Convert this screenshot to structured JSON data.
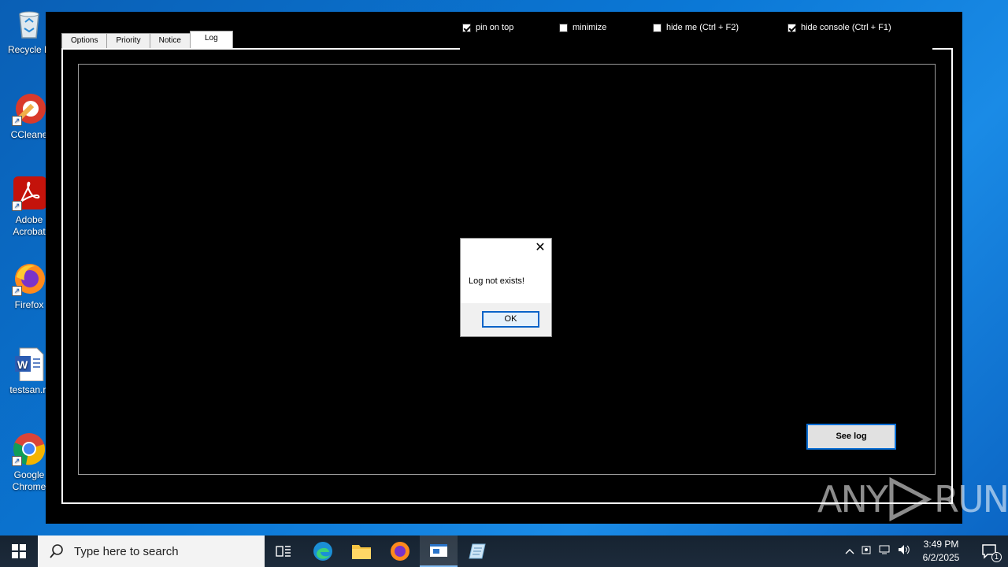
{
  "desktop": {
    "icons": [
      {
        "label": "Recycle B"
      },
      {
        "label": "CCleane"
      },
      {
        "label": "Adobe Acrobat",
        "line1": "Adobe",
        "line2": "Acrobat"
      },
      {
        "label": "Firefox"
      },
      {
        "label": "testsan.rt"
      },
      {
        "label": "Google Chrome",
        "line1": "Google",
        "line2": "Chrome"
      }
    ]
  },
  "app": {
    "tabs": [
      {
        "label": "Options"
      },
      {
        "label": "Priority"
      },
      {
        "label": "Notice"
      },
      {
        "label": "Log"
      }
    ],
    "active_tab": "Log",
    "options": [
      {
        "label": "pin on top",
        "checked": true
      },
      {
        "label": "minimize",
        "checked": false
      },
      {
        "label": "hide me (Ctrl + F2)",
        "checked": false
      },
      {
        "label": "hide console (Ctrl + F1)",
        "checked": true
      }
    ],
    "see_log_label": "See log"
  },
  "dialog": {
    "message": "Log not exists!",
    "ok_label": "OK",
    "close_symbol": "✕"
  },
  "taskbar": {
    "search_placeholder": "Type here to search",
    "time": "3:49 PM",
    "date": "6/2/2025",
    "notification_count": "1"
  },
  "watermark": {
    "text": "ANY RUN",
    "left": "ANY",
    "right": "RUN"
  }
}
